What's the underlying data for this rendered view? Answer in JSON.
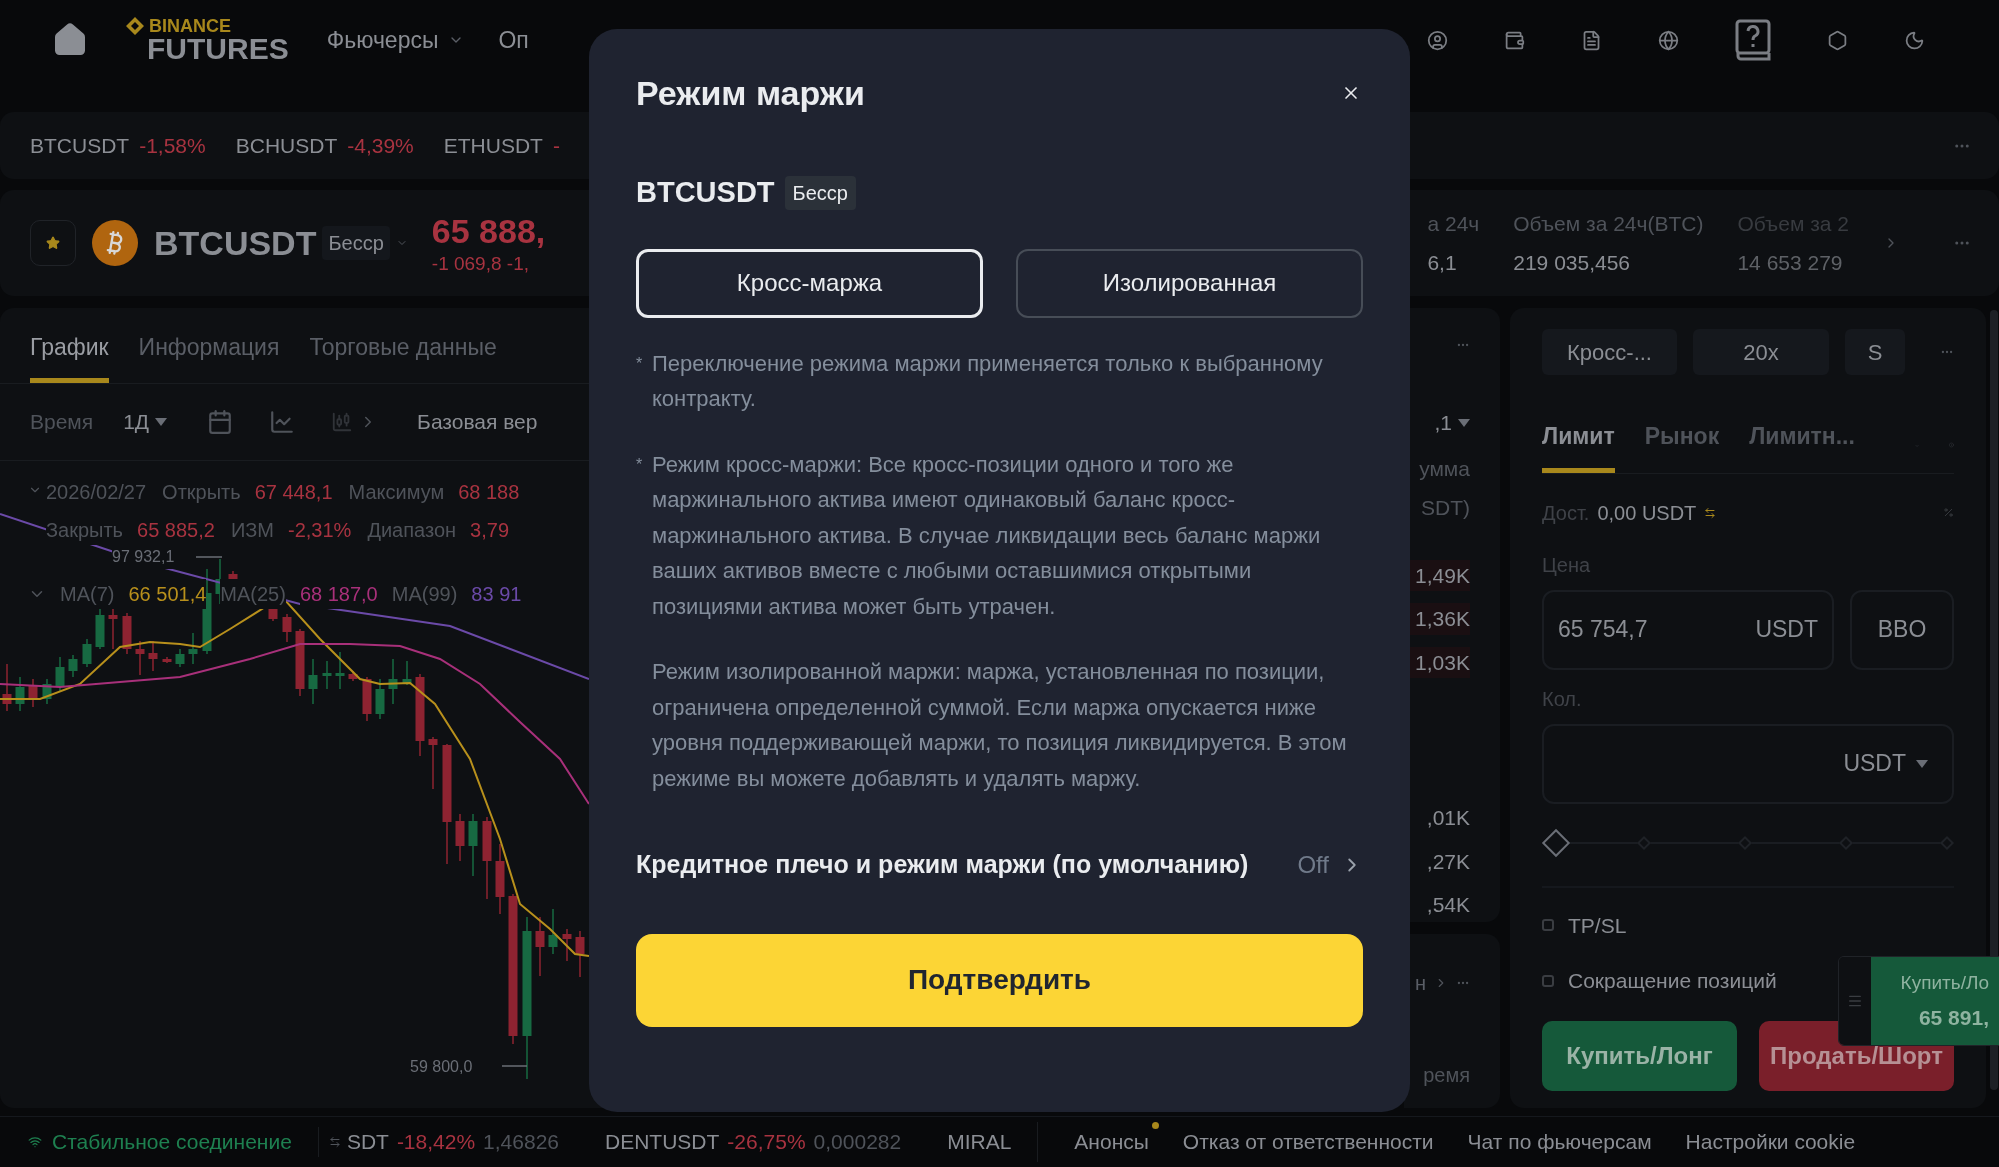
{
  "header": {
    "logo": {
      "brand": "BINANCE",
      "product": "FUTURES"
    },
    "nav": [
      {
        "label": "Фьючерсы",
        "caret": true
      },
      {
        "label": "Оп",
        "caret": false
      }
    ]
  },
  "ticker": [
    {
      "symbol": "BTCUSDT",
      "change": "-1,58%"
    },
    {
      "symbol": "BCHUSDT",
      "change": "-4,39%"
    },
    {
      "symbol": "ETHUSDT",
      "change": "-"
    }
  ],
  "symbol_bar": {
    "favorite": true,
    "symbol": "BTCUSDT",
    "contract_tag": "Бесср",
    "price": "65 888,",
    "change": "-1 069,8 -1,",
    "stats": [
      {
        "label": "а 24ч",
        "value": "6,1",
        "faded": false
      },
      {
        "label": "Объем за 24ч(BTC)",
        "value": "219 035,456",
        "faded": false
      },
      {
        "label": "Объем за 2",
        "value": "14 653 279",
        "faded": true
      }
    ]
  },
  "chart_panel": {
    "tabs": [
      {
        "label": "График",
        "selected": true
      },
      {
        "label": "Информация",
        "selected": false
      },
      {
        "label": "Торговые данные",
        "selected": false
      }
    ],
    "toolbar": {
      "time_label": "Время",
      "interval": "1Д",
      "layout_label": "Базовая вер"
    },
    "ohlc": {
      "date": "2026/02/27",
      "fields": [
        {
          "label": "Открыть",
          "value": "67 448,1"
        },
        {
          "label": "Максимум",
          "value": "68 188"
        },
        {
          "label": "Закрыть",
          "value": "65 885,2"
        },
        {
          "label": "ИЗМ",
          "value": "-2,31%"
        },
        {
          "label": "Диапазон",
          "value": "3,79"
        }
      ]
    },
    "ma": [
      {
        "label": "MA(7)",
        "value": "66 501,4",
        "color": "#b8901c"
      },
      {
        "label": "MA(25)",
        "value": "68 187,0",
        "color": "#a8307a"
      },
      {
        "label": "MA(99)",
        "value": "83 91",
        "color": "#6b4aa8"
      }
    ],
    "high_label": "97 932,1",
    "low_label": "59 800,0"
  },
  "order_book": {
    "precision": ",1",
    "header": [
      "умма",
      "SDT)"
    ],
    "asks": [
      "1,49K",
      "1,36K",
      "1,03K"
    ],
    "bids": [
      ",01K",
      ",27K",
      ",54K"
    ],
    "trades_header": "н",
    "trades_column": "ремя"
  },
  "order_panel": {
    "margin_mode": "Кросс-...",
    "leverage": "20x",
    "asset_mode": "S",
    "order_types": [
      {
        "label": "Лимит",
        "selected": true
      },
      {
        "label": "Рынок",
        "selected": false
      },
      {
        "label": "Лимитн...",
        "selected": false
      }
    ],
    "available_label": "Дост.",
    "available_value": "0,00 USDT",
    "price_label": "Цена",
    "price_value": "65 754,7",
    "price_unit": "USDT",
    "bbo": "BBO",
    "qty_label": "Кол.",
    "qty_unit": "USDT",
    "slider": {
      "level": 0
    },
    "options": [
      {
        "label": "TP/SL",
        "checked": false
      },
      {
        "label": "Сокращение позиций",
        "checked": false
      }
    ],
    "buy": "Купить/Лонг",
    "sell": "Продать/Шорт"
  },
  "floating_order": {
    "label": "Купить/Ло",
    "price": "65 891,"
  },
  "modal": {
    "title": "Режим маржи",
    "symbol": "BTCUSDT",
    "contract_tag": "Бесср",
    "modes": [
      {
        "label": "Кросс-маржа",
        "selected": true
      },
      {
        "label": "Изолированная",
        "selected": false
      }
    ],
    "notes": [
      {
        "bullet": "*",
        "text": "Переключение режима маржи применяется только к выбранному контракту."
      },
      {
        "bullet": "*",
        "text": "Режим кросс-маржи: Все кросс-позиции одного и того же маржинального актива имеют одинаковый баланс кросс-маржинального актива. В случае ликвидации весь баланс маржи ваших активов вместе с любыми оставшимися открытыми позициями актива может быть утрачен."
      },
      {
        "text": "Режим изолированной маржи: маржа, установленная по позиции, ограничена определенной суммой. Если маржа опускается ниже уровня поддерживающей маржи, то позиция ликвидируется. В этом режиме вы можете добавлять и удалять маржу."
      }
    ],
    "default_setting": {
      "label": "Кредитное плечо и режим маржи (по умолчанию)",
      "value": "Off"
    },
    "confirm": "Подтвердить"
  },
  "footer": {
    "connection": "Стабильное соединение",
    "tickers": [
      {
        "symbol": "SDT",
        "change": "-18,42%",
        "price": "1,46826"
      },
      {
        "symbol": "DENTUSDT",
        "change": "-26,75%",
        "price": "0,000282"
      },
      {
        "symbol": "MIRAL"
      }
    ],
    "links": [
      {
        "label": "Анонсы",
        "dot": true
      },
      {
        "label": "Отказ от ответственности",
        "dot": false
      },
      {
        "label": "Чат по фьючерсам",
        "dot": false
      },
      {
        "label": "Настройки cookie",
        "dot": false
      }
    ]
  }
}
